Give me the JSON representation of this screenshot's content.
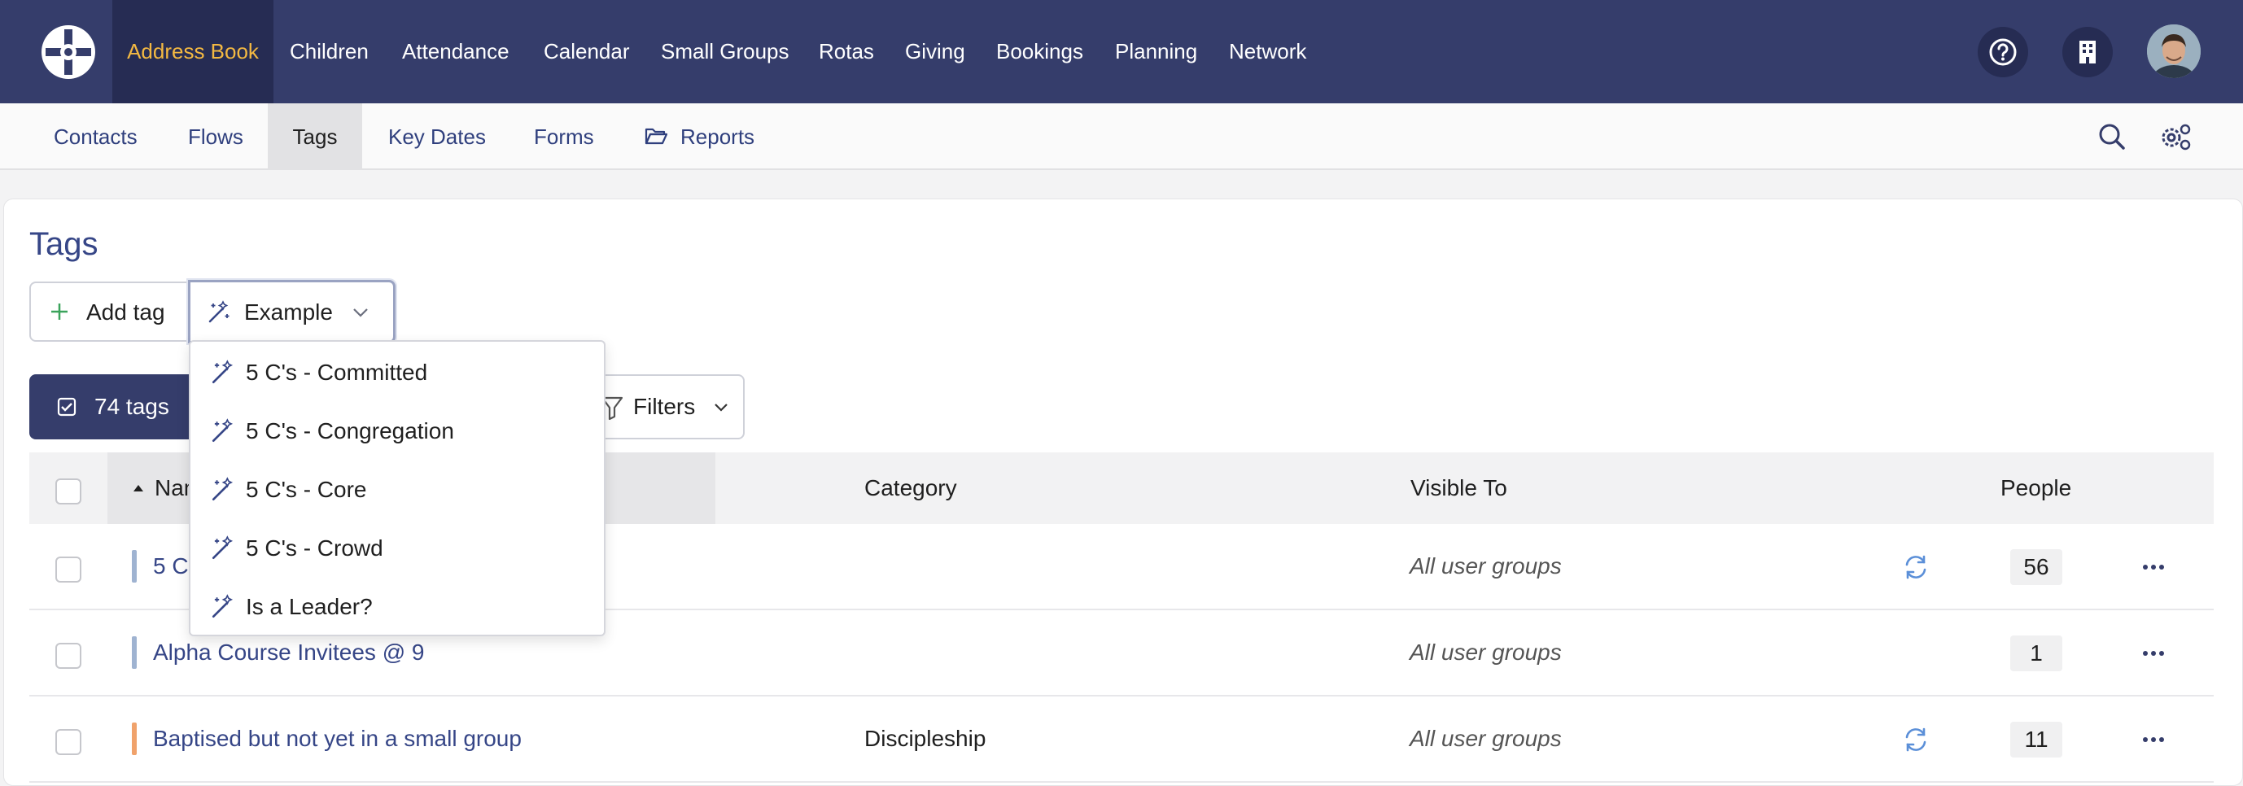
{
  "nav": {
    "items": [
      {
        "label": "Address Book",
        "active": true
      },
      {
        "label": "Children"
      },
      {
        "label": "Attendance"
      },
      {
        "label": "Calendar"
      },
      {
        "label": "Small Groups"
      },
      {
        "label": "Rotas"
      },
      {
        "label": "Giving"
      },
      {
        "label": "Bookings"
      },
      {
        "label": "Planning"
      },
      {
        "label": "Network"
      }
    ],
    "icons": [
      "help-icon",
      "building-icon",
      "user-avatar"
    ]
  },
  "subnav": {
    "items": [
      {
        "label": "Contacts"
      },
      {
        "label": "Flows"
      },
      {
        "label": "Tags",
        "active": true
      },
      {
        "label": "Key Dates"
      },
      {
        "label": "Forms"
      },
      {
        "label": "Reports",
        "icon": "folder-open-icon"
      }
    ],
    "icons": [
      "search-icon",
      "settings-icon"
    ]
  },
  "page": {
    "title": "Tags",
    "add_tag_label": "Add tag",
    "example_label": "Example",
    "tags_count_label": "74 tags",
    "filters_label": "Filters"
  },
  "dropdown": {
    "items": [
      {
        "label": "5 C's - Committed"
      },
      {
        "label": "5 C's - Congregation"
      },
      {
        "label": "5 C's - Core"
      },
      {
        "label": "5 C's - Crowd"
      },
      {
        "label": "Is a Leader?"
      }
    ]
  },
  "table": {
    "columns": {
      "name": "Name",
      "category": "Category",
      "visible_to": "Visible To",
      "people": "People"
    },
    "rows": [
      {
        "name": "5 C's - Committed",
        "category": "",
        "visible_to": "All user groups",
        "people": "56",
        "synced": true,
        "color": "#9fb3d1"
      },
      {
        "name": "Alpha Course Invitees @ 9",
        "category": "",
        "visible_to": "All user groups",
        "people": "1",
        "synced": false,
        "color": "#9fb3d1"
      },
      {
        "name": "Baptised but not yet in a small group",
        "category": "Discipleship",
        "visible_to": "All user groups",
        "people": "11",
        "synced": true,
        "color": "#f0a26b"
      }
    ]
  },
  "colors": {
    "nav_bg": "#353d6b",
    "nav_active_bg": "#262c53",
    "nav_active_text": "#f4b942",
    "link": "#364687",
    "add_icon": "#3aa35b",
    "sync_icon": "#5b8fd8"
  }
}
